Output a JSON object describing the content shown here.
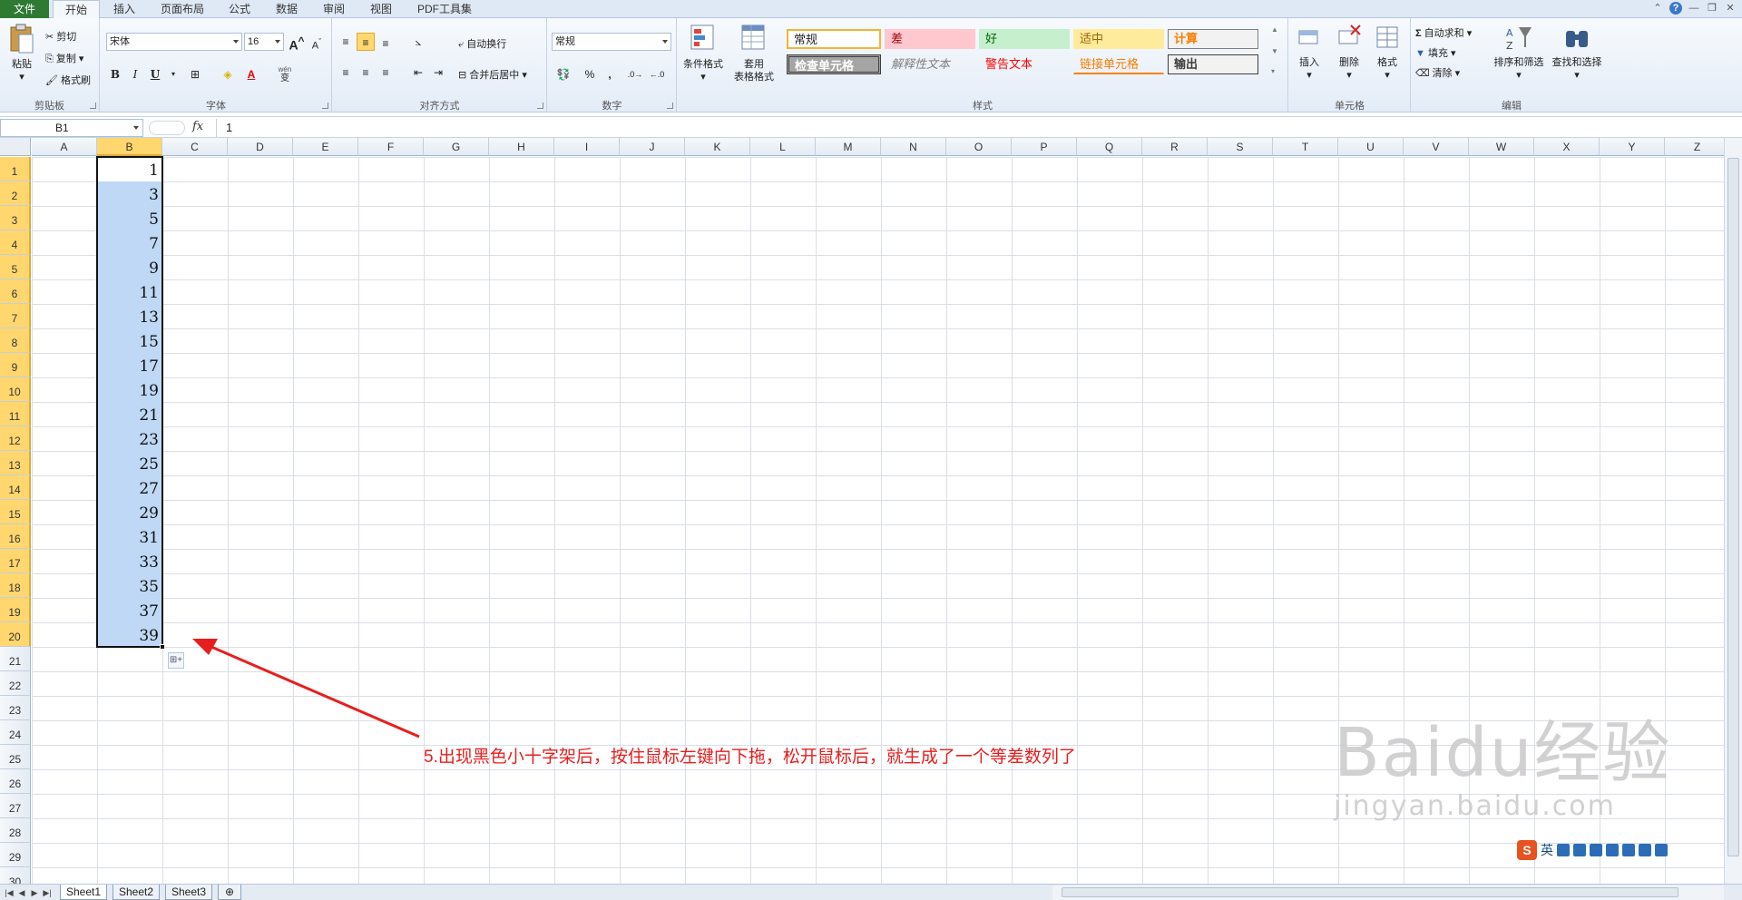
{
  "tabs": [
    "文件",
    "开始",
    "插入",
    "页面布局",
    "公式",
    "数据",
    "审阅",
    "视图",
    "PDF工具集"
  ],
  "window_controls": {
    "help": "?",
    "minimize": "—",
    "restore": "❐",
    "close": "✕"
  },
  "ribbon": {
    "clipboard": {
      "label": "剪贴板",
      "paste": "粘贴",
      "cut": "剪切",
      "copy": "复制",
      "painter": "格式刷"
    },
    "font": {
      "label": "字体",
      "name": "宋体",
      "size": "16",
      "grow": "A",
      "shrink": "A",
      "bold": "B",
      "italic": "I",
      "underline": "U",
      "wen": "wén",
      "phonetic": "变"
    },
    "alignment": {
      "label": "对齐方式",
      "wrap": "自动换行",
      "merge": "合并后居中"
    },
    "number": {
      "label": "数字",
      "format": "常规",
      "percent": "%",
      "comma": ","
    },
    "styles": {
      "label": "样式",
      "cond_format": "条件格式",
      "table_format": [
        "套用",
        "表格格式"
      ],
      "items": [
        "常规",
        "差",
        "好",
        "适中",
        "计算",
        "检查单元格",
        "解释性文本",
        "警告文本",
        "链接单元格",
        "输出"
      ]
    },
    "cells": {
      "label": "单元格",
      "insert": "插入",
      "delete": "删除",
      "format": "格式"
    },
    "editing": {
      "label": "编辑",
      "autosum": "自动求和",
      "fill": "填充",
      "clear": "清除",
      "sort": "排序和筛选",
      "find": "查找和选择"
    }
  },
  "formula_bar": {
    "name_box": "B1",
    "fx": "fx",
    "content": "1"
  },
  "columns": [
    "A",
    "B",
    "C",
    "D",
    "E",
    "F",
    "G",
    "H",
    "I",
    "J",
    "K",
    "L",
    "M",
    "N",
    "O",
    "P",
    "Q",
    "R",
    "S",
    "T",
    "U",
    "V",
    "W",
    "X",
    "Y",
    "Z"
  ],
  "rows": [
    "1",
    "2",
    "3",
    "4",
    "5",
    "6",
    "7",
    "8",
    "9",
    "10",
    "11",
    "12",
    "13",
    "14",
    "15",
    "16",
    "17",
    "18",
    "19",
    "20",
    "21",
    "22",
    "23",
    "24",
    "25",
    "26",
    "27",
    "28",
    "29",
    "30"
  ],
  "cells_B": [
    "1",
    "3",
    "5",
    "7",
    "9",
    "11",
    "13",
    "15",
    "17",
    "19",
    "21",
    "23",
    "25",
    "27",
    "29",
    "31",
    "33",
    "35",
    "37",
    "39"
  ],
  "annotation": "5.出现黑色小十字架后，按住鼠标左键向下拖，松开鼠标后，就生成了一个等差数列了",
  "sheets": [
    "Sheet1",
    "Sheet2",
    "Sheet3"
  ],
  "watermark": {
    "main": "Baidu经验",
    "url": "jingyan.baidu.com"
  },
  "ime": {
    "mode": "英"
  }
}
